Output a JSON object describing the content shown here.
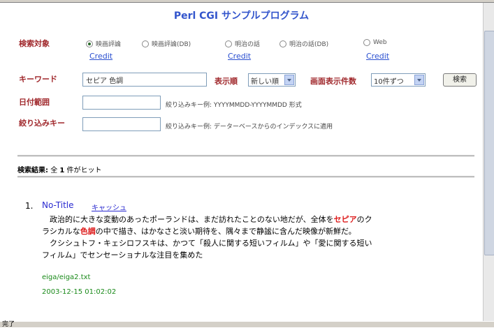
{
  "page": {
    "title": "Perl CGI サンプルプログラム"
  },
  "search_form": {
    "target_label": "検索対象",
    "targets": [
      {
        "label": "映画評論",
        "selected": true,
        "credit": "Credit"
      },
      {
        "label": "映画評論(DB)",
        "selected": false,
        "credit": ""
      },
      {
        "label": "明治の話",
        "selected": false,
        "credit": "Credit"
      },
      {
        "label": "明治の話(DB)",
        "selected": false,
        "credit": ""
      },
      {
        "label": "Web",
        "selected": false,
        "credit": "Credit"
      }
    ],
    "keyword_label": "キーワード",
    "keyword_value": "セピア 色調",
    "order_label": "表示順",
    "order_value": "新しい順",
    "count_label": "画面表示件数",
    "count_value": "10件ずつ",
    "search_button": "検索",
    "date_label": "日付範囲",
    "date_value": "",
    "date_note": "絞り込みキー例: YYYYMMDD-YYYYMMDD 形式",
    "filter_label": "絞り込みキー",
    "filter_value": "",
    "filter_note": "絞り込みキー例: データーベースからのインデックスに適用"
  },
  "summary": {
    "label": "検索結果:",
    "prefix": "全",
    "count": "1",
    "suffix": "件がヒット"
  },
  "results": [
    {
      "number": "1.",
      "title": "No-Title",
      "cache_label": "キャッシュ",
      "snippet": {
        "a": "　政治的に大きな変動のあったポーランドは、まだ訪れたことのない地だが、全体を",
        "h1": "セピア",
        "b": "のクラシカルな",
        "h2": "色調",
        "c": "の中で描き、はかなさと淡い期待を、隅々まで静謐に含んだ映像が新鮮だ。",
        "d": "　クシシュトフ・キェシロフスキは、かつて「殺人に関する短いフィルム」や「愛に関する短いフィルム」でセンセーショナルな注目を集めた"
      },
      "path": "eiga/eiga2.txt",
      "date": "2003-12-15 01:02:02"
    }
  ],
  "statusbar": {
    "text": "完了"
  },
  "colors": {
    "label": "#a0282c",
    "link": "#2a4fd0",
    "highlight": "#dd1a1a",
    "meta": "#1a8a1a",
    "title": "#3355cc"
  }
}
